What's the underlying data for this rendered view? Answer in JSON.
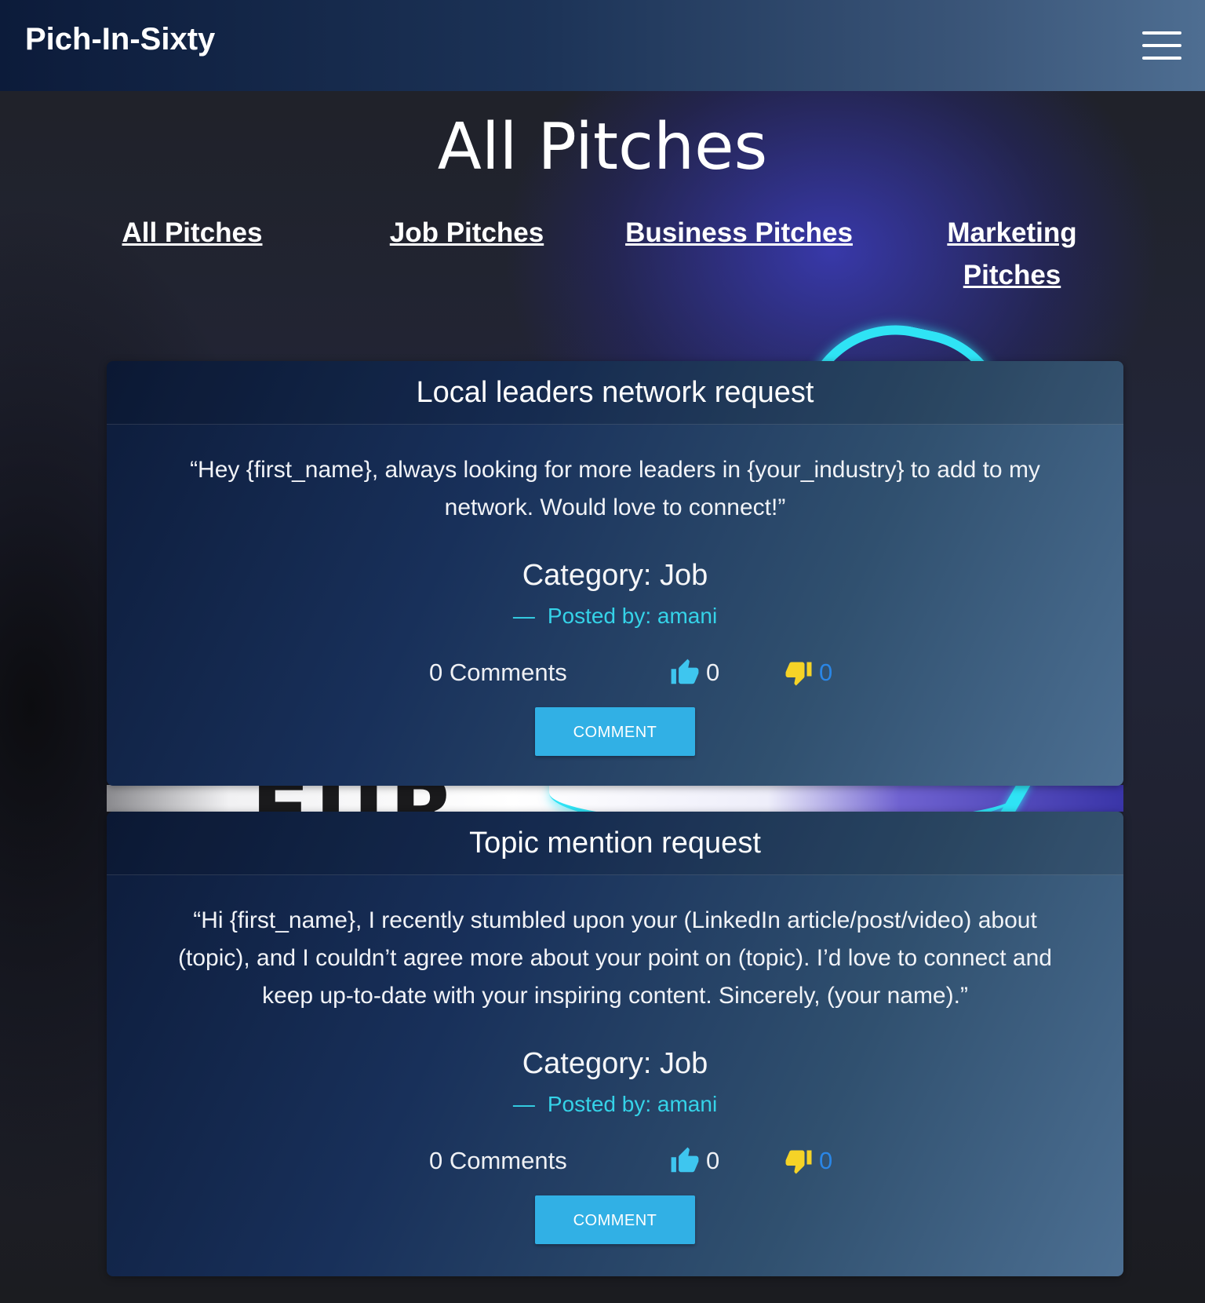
{
  "navbar": {
    "brand": "Pich-In-Sixty",
    "menu_icon": "hamburger-menu-icon"
  },
  "page": {
    "title": "All Pitches"
  },
  "categories": [
    {
      "label": "All Pitches"
    },
    {
      "label": "Job Pitches"
    },
    {
      "label": "Business Pitches"
    },
    {
      "label": "Marketing Pitches"
    }
  ],
  "pitches": [
    {
      "title": "Local leaders network request",
      "quote": "“Hey {first_name}, always looking for more leaders in {your_industry} to add to my network. Would love to connect!”",
      "category": "Category: Job",
      "author_dash": "—",
      "author": "Posted by: amani",
      "comments": "0 Comments",
      "likes": "0",
      "dislikes": "0",
      "button": "COMMENT"
    },
    {
      "title": "Topic mention request",
      "quote": "“Hi {first_name}, I recently stumbled upon your (LinkedIn article/post/video) about (topic), and I couldn’t agree more about your point on (topic). I’d love to connect and keep up-to-date with your inspiring content. Sincerely, (your name).”",
      "category": "Category: Job",
      "author_dash": "—",
      "author": "Posted by: amani",
      "comments": "0 Comments",
      "likes": "0",
      "dislikes": "0",
      "button": "COMMENT"
    }
  ],
  "colors": {
    "accent": "#31b0e5",
    "author": "#35d3e8",
    "like_icon": "#3ec6ef",
    "dislike_icon": "#f5d327",
    "dislike_count": "#2a86e6"
  }
}
